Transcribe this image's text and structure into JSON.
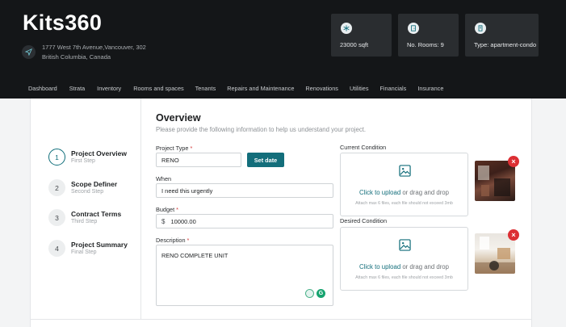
{
  "app": {
    "logo": "Kits360"
  },
  "address": {
    "line1": "1777 West 7th Avenue,Vancouver, 302",
    "line2": "British Columbia, Canada"
  },
  "stats": [
    {
      "icon": "snowflake-icon",
      "label": "23000 sqft"
    },
    {
      "icon": "door-icon",
      "label": "No. Rooms: 9"
    },
    {
      "icon": "building-icon",
      "label": "Type: apartment-condo"
    }
  ],
  "nav": [
    "Dashboard",
    "Strata",
    "Inventory",
    "Rooms and spaces",
    "Tenants",
    "Repairs and Maintenance",
    "Renovations",
    "Utilities",
    "Financials",
    "Insurance"
  ],
  "steps": [
    {
      "num": "1",
      "title": "Project Overview",
      "sub": "First Step",
      "active": true
    },
    {
      "num": "2",
      "title": "Scope Definer",
      "sub": "Second Step",
      "active": false
    },
    {
      "num": "3",
      "title": "Contract Terms",
      "sub": "Third Step",
      "active": false
    },
    {
      "num": "4",
      "title": "Project Summary",
      "sub": "Final Step",
      "active": false
    }
  ],
  "form": {
    "title": "Overview",
    "subtitle": "Please provide the following information to help us understand your project.",
    "project_type_label": "Project Type",
    "project_type_value": "RENO",
    "set_date_label": "Set date",
    "when_label": "When",
    "when_value": "I need this urgently",
    "budget_label": "Budget",
    "budget_currency": "$",
    "budget_value": "10000.00",
    "description_label": "Description",
    "description_value": "RENO COMPLETE UNIT",
    "required_mark": "*"
  },
  "uploads": {
    "current_label": "Current Condition",
    "desired_label": "Desired Condition",
    "click_text": "Click to upload",
    "or_text": " or drag and drop",
    "hint": "Attach max 6 files, each file should not exceed 3mb",
    "remove_glyph": "×"
  },
  "colors": {
    "accent": "#136e7b",
    "header_bg": "#141618",
    "danger": "#dc2f34"
  }
}
